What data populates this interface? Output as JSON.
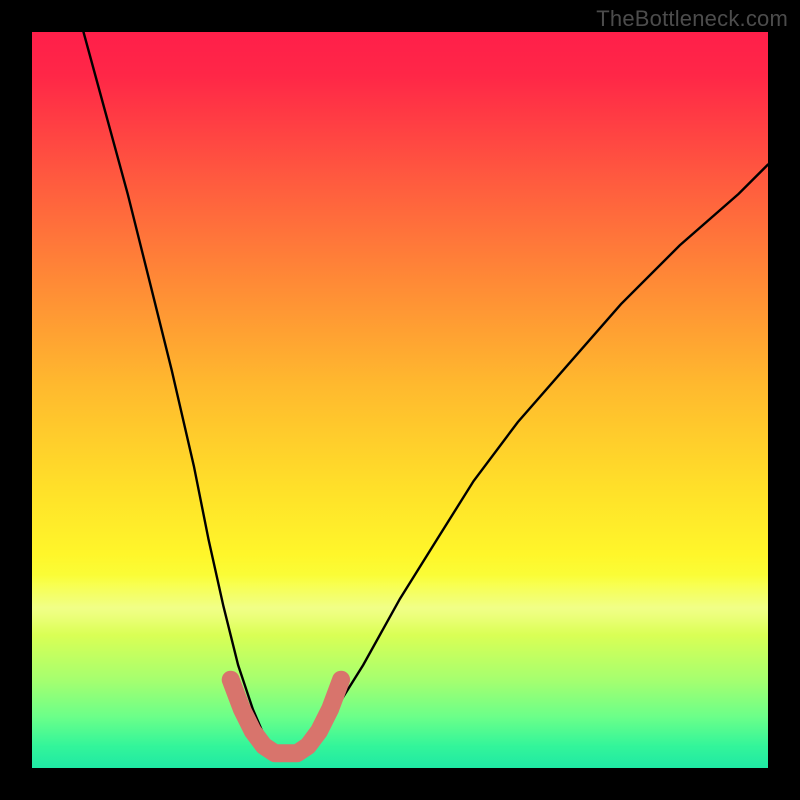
{
  "attribution": "TheBottleneck.com",
  "chart_data": {
    "type": "line",
    "title": "",
    "xlabel": "",
    "ylabel": "",
    "xlim": [
      0,
      100
    ],
    "ylim": [
      0,
      100
    ],
    "series": [
      {
        "name": "bottleneck-curve",
        "x": [
          7,
          10,
          13,
          16,
          19,
          22,
          24,
          26,
          28,
          30,
          31.5,
          33,
          35,
          37,
          40,
          45,
          50,
          55,
          60,
          66,
          73,
          80,
          88,
          96,
          100
        ],
        "values": [
          100,
          89,
          78,
          66,
          54,
          41,
          31,
          22,
          14,
          8,
          4.5,
          2.5,
          2,
          2.5,
          6,
          14,
          23,
          31,
          39,
          47,
          55,
          63,
          71,
          78,
          82
        ]
      },
      {
        "name": "marker-band",
        "x": [
          27,
          28.5,
          30,
          31.5,
          33,
          34.5,
          36,
          37.5,
          39,
          40.5,
          42
        ],
        "values": [
          12,
          8,
          5,
          3,
          2,
          2,
          2,
          3,
          5,
          8,
          12
        ]
      }
    ],
    "gradient_stops": [
      {
        "pos": 0,
        "color": "#ff1f4a"
      },
      {
        "pos": 20,
        "color": "#ff5a3f"
      },
      {
        "pos": 48,
        "color": "#ffb92e"
      },
      {
        "pos": 71,
        "color": "#fff62a"
      },
      {
        "pos": 88,
        "color": "#a6ff6f"
      },
      {
        "pos": 100,
        "color": "#1fe9a4"
      }
    ]
  }
}
